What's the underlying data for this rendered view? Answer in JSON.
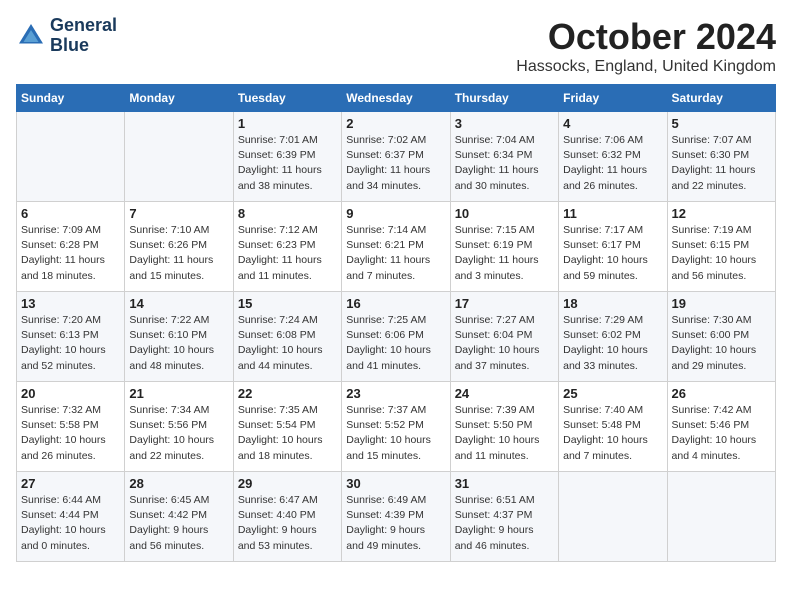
{
  "header": {
    "logo_line1": "General",
    "logo_line2": "Blue",
    "month": "October 2024",
    "location": "Hassocks, England, United Kingdom"
  },
  "days_of_week": [
    "Sunday",
    "Monday",
    "Tuesday",
    "Wednesday",
    "Thursday",
    "Friday",
    "Saturday"
  ],
  "weeks": [
    [
      {
        "day": "",
        "info": ""
      },
      {
        "day": "",
        "info": ""
      },
      {
        "day": "1",
        "info": "Sunrise: 7:01 AM\nSunset: 6:39 PM\nDaylight: 11 hours\nand 38 minutes."
      },
      {
        "day": "2",
        "info": "Sunrise: 7:02 AM\nSunset: 6:37 PM\nDaylight: 11 hours\nand 34 minutes."
      },
      {
        "day": "3",
        "info": "Sunrise: 7:04 AM\nSunset: 6:34 PM\nDaylight: 11 hours\nand 30 minutes."
      },
      {
        "day": "4",
        "info": "Sunrise: 7:06 AM\nSunset: 6:32 PM\nDaylight: 11 hours\nand 26 minutes."
      },
      {
        "day": "5",
        "info": "Sunrise: 7:07 AM\nSunset: 6:30 PM\nDaylight: 11 hours\nand 22 minutes."
      }
    ],
    [
      {
        "day": "6",
        "info": "Sunrise: 7:09 AM\nSunset: 6:28 PM\nDaylight: 11 hours\nand 18 minutes."
      },
      {
        "day": "7",
        "info": "Sunrise: 7:10 AM\nSunset: 6:26 PM\nDaylight: 11 hours\nand 15 minutes."
      },
      {
        "day": "8",
        "info": "Sunrise: 7:12 AM\nSunset: 6:23 PM\nDaylight: 11 hours\nand 11 minutes."
      },
      {
        "day": "9",
        "info": "Sunrise: 7:14 AM\nSunset: 6:21 PM\nDaylight: 11 hours\nand 7 minutes."
      },
      {
        "day": "10",
        "info": "Sunrise: 7:15 AM\nSunset: 6:19 PM\nDaylight: 11 hours\nand 3 minutes."
      },
      {
        "day": "11",
        "info": "Sunrise: 7:17 AM\nSunset: 6:17 PM\nDaylight: 10 hours\nand 59 minutes."
      },
      {
        "day": "12",
        "info": "Sunrise: 7:19 AM\nSunset: 6:15 PM\nDaylight: 10 hours\nand 56 minutes."
      }
    ],
    [
      {
        "day": "13",
        "info": "Sunrise: 7:20 AM\nSunset: 6:13 PM\nDaylight: 10 hours\nand 52 minutes."
      },
      {
        "day": "14",
        "info": "Sunrise: 7:22 AM\nSunset: 6:10 PM\nDaylight: 10 hours\nand 48 minutes."
      },
      {
        "day": "15",
        "info": "Sunrise: 7:24 AM\nSunset: 6:08 PM\nDaylight: 10 hours\nand 44 minutes."
      },
      {
        "day": "16",
        "info": "Sunrise: 7:25 AM\nSunset: 6:06 PM\nDaylight: 10 hours\nand 41 minutes."
      },
      {
        "day": "17",
        "info": "Sunrise: 7:27 AM\nSunset: 6:04 PM\nDaylight: 10 hours\nand 37 minutes."
      },
      {
        "day": "18",
        "info": "Sunrise: 7:29 AM\nSunset: 6:02 PM\nDaylight: 10 hours\nand 33 minutes."
      },
      {
        "day": "19",
        "info": "Sunrise: 7:30 AM\nSunset: 6:00 PM\nDaylight: 10 hours\nand 29 minutes."
      }
    ],
    [
      {
        "day": "20",
        "info": "Sunrise: 7:32 AM\nSunset: 5:58 PM\nDaylight: 10 hours\nand 26 minutes."
      },
      {
        "day": "21",
        "info": "Sunrise: 7:34 AM\nSunset: 5:56 PM\nDaylight: 10 hours\nand 22 minutes."
      },
      {
        "day": "22",
        "info": "Sunrise: 7:35 AM\nSunset: 5:54 PM\nDaylight: 10 hours\nand 18 minutes."
      },
      {
        "day": "23",
        "info": "Sunrise: 7:37 AM\nSunset: 5:52 PM\nDaylight: 10 hours\nand 15 minutes."
      },
      {
        "day": "24",
        "info": "Sunrise: 7:39 AM\nSunset: 5:50 PM\nDaylight: 10 hours\nand 11 minutes."
      },
      {
        "day": "25",
        "info": "Sunrise: 7:40 AM\nSunset: 5:48 PM\nDaylight: 10 hours\nand 7 minutes."
      },
      {
        "day": "26",
        "info": "Sunrise: 7:42 AM\nSunset: 5:46 PM\nDaylight: 10 hours\nand 4 minutes."
      }
    ],
    [
      {
        "day": "27",
        "info": "Sunrise: 6:44 AM\nSunset: 4:44 PM\nDaylight: 10 hours\nand 0 minutes."
      },
      {
        "day": "28",
        "info": "Sunrise: 6:45 AM\nSunset: 4:42 PM\nDaylight: 9 hours\nand 56 minutes."
      },
      {
        "day": "29",
        "info": "Sunrise: 6:47 AM\nSunset: 4:40 PM\nDaylight: 9 hours\nand 53 minutes."
      },
      {
        "day": "30",
        "info": "Sunrise: 6:49 AM\nSunset: 4:39 PM\nDaylight: 9 hours\nand 49 minutes."
      },
      {
        "day": "31",
        "info": "Sunrise: 6:51 AM\nSunset: 4:37 PM\nDaylight: 9 hours\nand 46 minutes."
      },
      {
        "day": "",
        "info": ""
      },
      {
        "day": "",
        "info": ""
      }
    ]
  ]
}
